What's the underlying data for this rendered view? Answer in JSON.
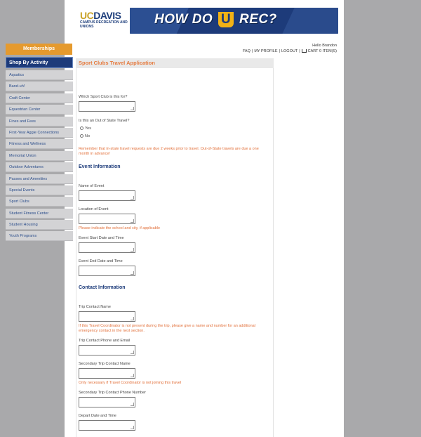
{
  "header": {
    "logo_uc": "UC",
    "logo_davis": "DAVIS",
    "logo_sub": "CAMPUS RECREATION AND UNIONS",
    "banner_pre": "HOW DO",
    "banner_u": "U",
    "banner_post": "REC?"
  },
  "account": {
    "hello": "Hello Brandon",
    "faq": "FAQ",
    "profile": "MY PROFILE",
    "logout": "LOGOUT",
    "cart": "CART 0 ITEM(S)"
  },
  "sidebar": {
    "memberships": "Memberships",
    "shop_title": "Shop By Activity",
    "items": [
      "Aquatics",
      "Band-uh!",
      "Craft Center",
      "Equestrian Center",
      "Fines and Fees",
      "First-Year Aggie Connections",
      "Fitness and Wellness",
      "Memorial Union",
      "Outdoor Adventures",
      "Passes and Amenities",
      "Special Events",
      "Sport Clubs",
      "Student Fitness Center",
      "Student Housing",
      "Youth Programs"
    ]
  },
  "form": {
    "title": "Sport Clubs Travel Application",
    "q_club": "Which Sport Club is this for?",
    "q_out_of_state": "Is this an Out of State Travel?",
    "opt_yes": "Yes",
    "opt_no": "No",
    "reminder": "Remember that in-state travel requests are due 2 weeks prior to travel. Out-of-State travels are due a one month in advance!",
    "sec_event": "Event Information",
    "event_name": "Name of Event",
    "event_location": "Location of Event",
    "location_note": "Please indicate the school and city, if applicable",
    "event_start": "Event Start Date and Time",
    "event_end": "Event End Date and Time",
    "sec_contact": "Contact Information",
    "trip_contact": "Trip Contact Name",
    "trip_contact_note": "If this Travel Coordinator is not present during the trip, please give a name and number for an additional emergency contact in the next section.",
    "trip_contact_phone": "Trip Contact Phone and Email",
    "secondary_contact": "Secondary Trip Contact Name",
    "secondary_note": "Only necessary if Travel Coordinator is not joining this travel",
    "secondary_phone": "Secondary Trip Contact Phone Number",
    "depart": "Depart Date and Time"
  }
}
